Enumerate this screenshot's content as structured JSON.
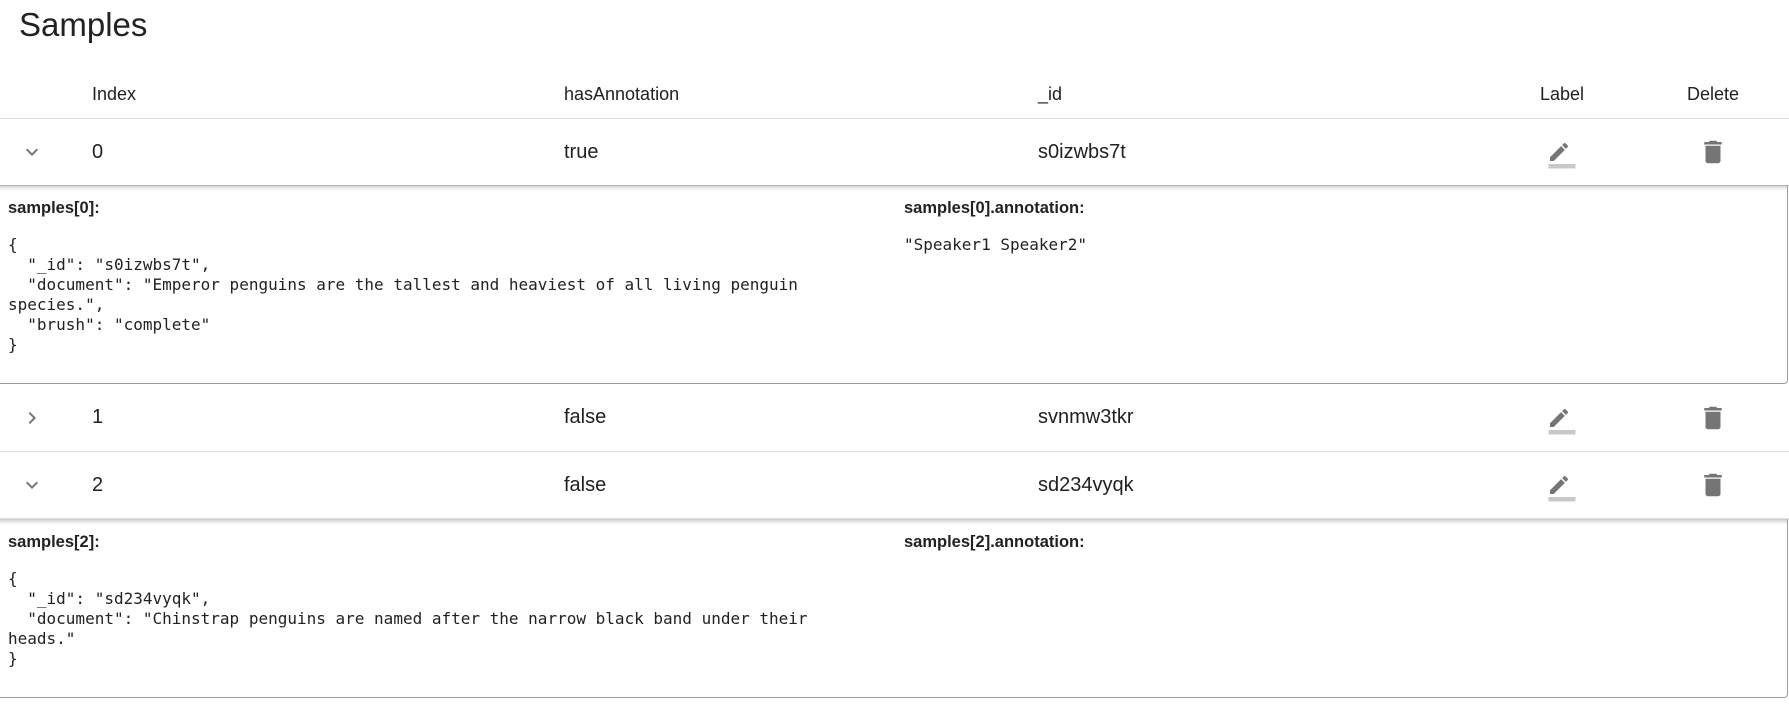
{
  "title": "Samples",
  "columns": {
    "index": "Index",
    "hasAnnotation": "hasAnnotation",
    "id": "_id",
    "label": "Label",
    "delete": "Delete"
  },
  "rows": [
    {
      "index": "0",
      "hasAnnotation": "true",
      "id": "s0izwbs7t",
      "expanded": true,
      "sample_label": "samples[0]:",
      "annotation_label": "samples[0].annotation:",
      "json": "{\n  \"_id\": \"s0izwbs7t\",\n  \"document\": \"Emperor penguins are the tallest and heaviest of all living penguin species.\",\n  \"brush\": \"complete\"\n}",
      "annotation": "\"Speaker1 Speaker2\""
    },
    {
      "index": "1",
      "hasAnnotation": "false",
      "id": "svnmw3tkr",
      "expanded": false
    },
    {
      "index": "2",
      "hasAnnotation": "false",
      "id": "sd234vyqk",
      "expanded": true,
      "sample_label": "samples[2]:",
      "annotation_label": "samples[2].annotation:",
      "json": "{\n  \"_id\": \"sd234vyqk\",\n  \"document\": \"Chinstrap penguins are named after the narrow black band under their heads.\"\n}",
      "annotation": ""
    }
  ],
  "colors": {
    "icon": "#757575",
    "underline": "#c8c8c8",
    "divider": "#e0e0e0"
  }
}
